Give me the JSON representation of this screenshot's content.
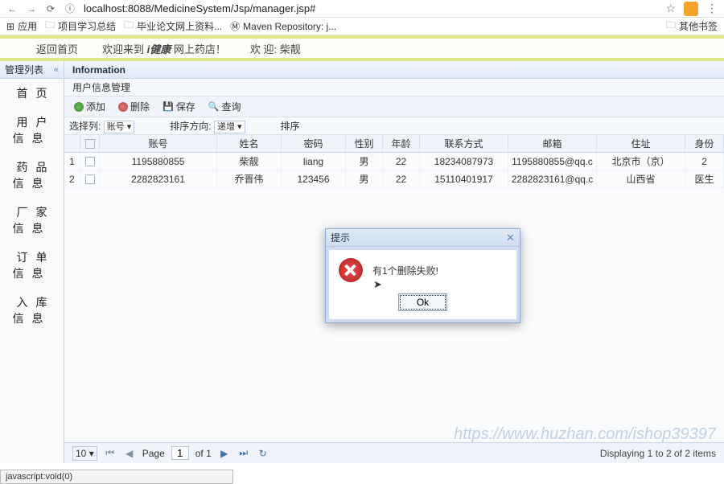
{
  "browser": {
    "url": "localhost:8088/MedicineSystem/Jsp/manager.jsp#"
  },
  "bookmarks": {
    "apps": "应用",
    "b1": "项目学习总结",
    "b2": "毕业论文网上资料...",
    "b3": "Maven Repository: j...",
    "other": "其他书签"
  },
  "header": {
    "back": "返回首页",
    "welcome_pre": "欢迎来到 ",
    "brand": "i健康",
    "welcome_post": " 网上药店！",
    "user": "欢 迎: 柴靓"
  },
  "sidebar": {
    "title": "管理列表",
    "items": [
      "首页",
      "用户信息",
      "药品信息",
      "厂家信息",
      "订单信息",
      "入库信息"
    ]
  },
  "panel": {
    "title": "Information",
    "sub": "用户信息管理"
  },
  "tools": {
    "add": "添加",
    "del": "删除",
    "save": "保存",
    "search": "查询"
  },
  "selrow": {
    "select_lbl": "选择列:",
    "select_val": "账号",
    "sort_lbl": "排序方向:",
    "sort_val": "递增",
    "sort_btn": "排序"
  },
  "cols": [
    "账号",
    "姓名",
    "密码",
    "性别",
    "年龄",
    "联系方式",
    "邮箱",
    "住址",
    "身份"
  ],
  "rows": [
    {
      "n": "1",
      "acct": "1195880855",
      "name": "柴靓",
      "pwd": "liang",
      "sex": "男",
      "age": "22",
      "tel": "18234087973",
      "mail": "1195880855@qq.c",
      "addr": "北京市（京）",
      "id": "2"
    },
    {
      "n": "2",
      "acct": "2282823161",
      "name": "乔晋伟",
      "pwd": "123456",
      "sex": "男",
      "age": "22",
      "tel": "15110401917",
      "mail": "2282823161@qq.c",
      "addr": "山西省",
      "id": "医生"
    }
  ],
  "pager": {
    "size": "10",
    "page_lbl": "Page",
    "page": "1",
    "of": "of 1",
    "info": "Displaying 1 to 2 of 2 items"
  },
  "modal": {
    "title": "提示",
    "msg": "有1个删除失败!",
    "ok": "Ok"
  },
  "watermark": "https://www.huzhan.com/ishop39397",
  "status": "javascript:void(0)"
}
